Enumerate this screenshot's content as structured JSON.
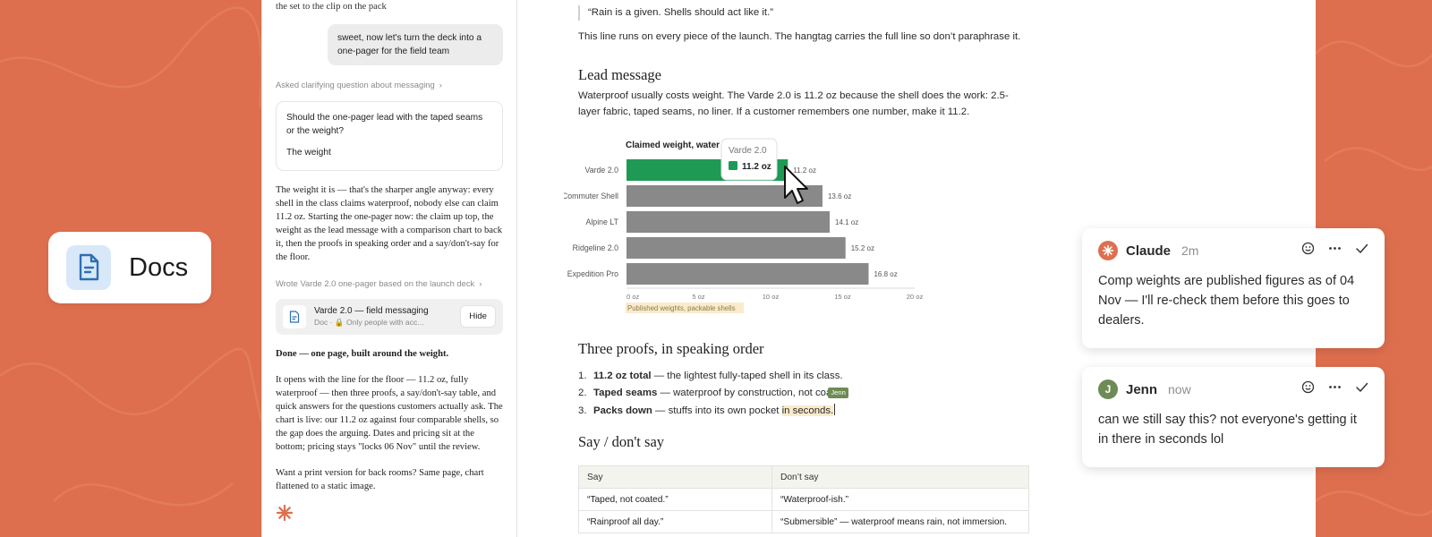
{
  "colors": {
    "background": "#DE6F4E",
    "bar_highlight": "#1E9A54",
    "bar_default": "#898989",
    "highlight": "#FAEBCC",
    "jenn": "#6E8B55"
  },
  "docs_badge": {
    "icon": "document-icon",
    "label": "Docs"
  },
  "chat": {
    "top_fragment": "the set to the clip on the pack",
    "user_message": "sweet, now let's turn the deck into a one-pager for the field team",
    "step1": "Asked clarifying question about messaging",
    "clarify": {
      "question": "Should the one-pager lead with the taped seams or the weight?",
      "answer": "The weight"
    },
    "response1": "The weight it is — that's the sharper angle anyway: every shell in the class claims waterproof, nobody else can claim 11.2 oz. Starting the one-pager now: the claim up top, the weight as the lead message with a comparison chart to back it, then the proofs in speaking order and a say/don't-say for the floor.",
    "step2": "Wrote Varde 2.0 one-pager based on the launch deck",
    "doc_card": {
      "title": "Varde 2.0 — field messaging",
      "subtitle": "Doc · 🔒 Only people with acc...",
      "hide_label": "Hide"
    },
    "done": "Done — one page, built around the weight.",
    "response2": "It opens with the line for the floor — 11.2 oz, fully waterproof — then three proofs, a say/don't-say table, and quick answers for the questions customers actually ask. The chart is live: our 11.2 oz against four comparable shells, so the gap does the arguing. Dates and pricing sit at the bottom; pricing stays \"locks 06 Nov\" until the review.",
    "response3": "Want a print version for back rooms? Same page, chart flattened to a static image."
  },
  "doc": {
    "quote": "“Rain is a given. Shells should act like it.”",
    "quote_note": "This line runs on every piece of the launch. The hangtag carries the full line so don’t paraphrase it.",
    "lead_heading": "Lead message",
    "lead_text": "Waterproof usually costs weight. The Varde 2.0 is 11.2 oz because the shell does the work: 2.5-layer fabric, taped seams, no liner. If a customer remembers one number, make it 11.2.",
    "proofs_heading": "Three proofs, in speaking order",
    "proofs": [
      {
        "num": "1.",
        "bold": "11.2 oz total",
        "rest": " — the lightest fully-taped shell in its class."
      },
      {
        "num": "2.",
        "bold": "Taped seams",
        "rest": " — waterproof by construction, not coa"
      },
      {
        "num": "3.",
        "bold": "Packs down",
        "rest": " — stuffs into its own pocket ",
        "highlight": "in seconds."
      }
    ],
    "cursor_tag": "Jenn",
    "say_heading": "Say / don't say",
    "table": {
      "headers": [
        "Say",
        "Don’t say"
      ],
      "rows": [
        [
          "“Taped, not coated.”",
          "“Waterproof-ish.”"
        ],
        [
          "“Rainproof all day.”",
          "“Submersible” — waterproof means rain, not immersion."
        ]
      ]
    }
  },
  "chart_data": {
    "type": "bar",
    "orientation": "horizontal",
    "title": "Claimed weight, water",
    "categories": [
      "Varde 2.0",
      "Commuter Shell",
      "Alpine LT",
      "Ridgeline 2.0",
      "Expedition Pro"
    ],
    "values": [
      11.2,
      13.6,
      14.1,
      15.2,
      16.8
    ],
    "value_labels": [
      "11.2 oz",
      "13.6 oz",
      "14.1 oz",
      "15.2 oz",
      "16.8 oz"
    ],
    "xlim": [
      0,
      20
    ],
    "xticks": [
      "0 oz",
      "5 oz",
      "10 oz",
      "15 oz",
      "20 oz"
    ],
    "highlight_index": 0,
    "source_note": "Published weights, packable shells",
    "tooltip": {
      "title": "Varde 2.0",
      "value": "11.2 oz"
    }
  },
  "comments": [
    {
      "author": "Claude",
      "time": "2m",
      "body": "Comp weights are published figures as of 04 Nov — I'll re-check them before this goes to dealers."
    },
    {
      "author": "Jenn",
      "initial": "J",
      "time": "now",
      "body": "can we still say this? not everyone's getting it in there in seconds lol"
    }
  ]
}
